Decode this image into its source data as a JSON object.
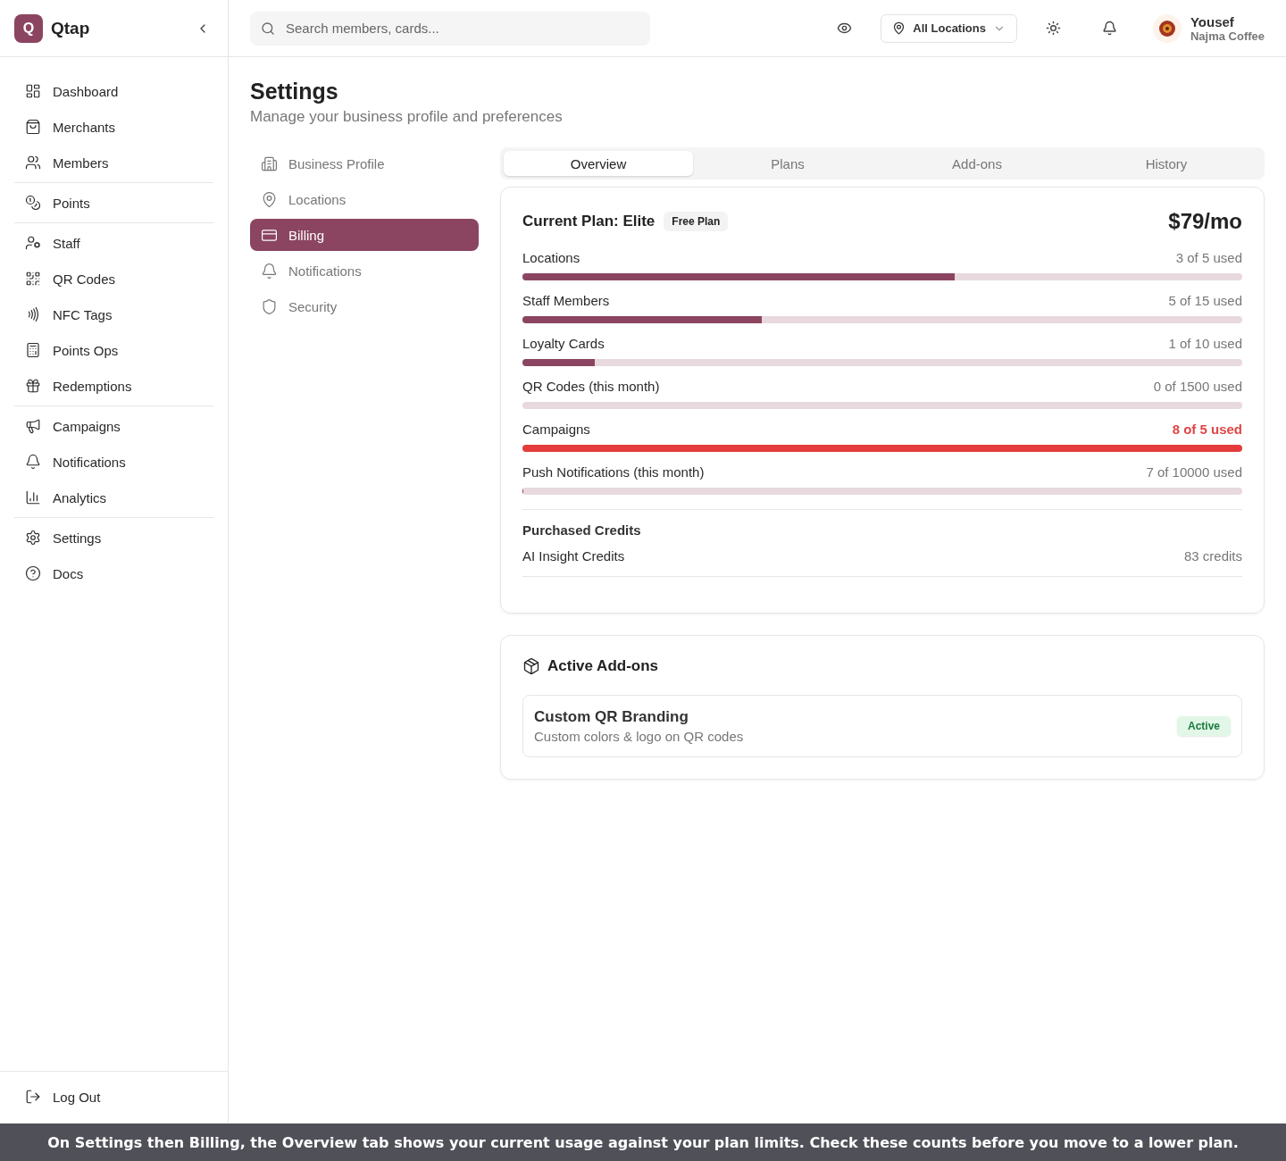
{
  "brand": {
    "letter": "Q",
    "name": "Qtap"
  },
  "nav_groups": [
    {
      "items": [
        {
          "label": "Dashboard",
          "selected": false
        },
        {
          "label": "Merchants",
          "selected": false
        },
        {
          "label": "Members",
          "selected": false
        }
      ]
    },
    {
      "items": [
        {
          "label": "Points",
          "selected": false
        }
      ]
    },
    {
      "items": [
        {
          "label": "Staff",
          "selected": false
        },
        {
          "label": "QR Codes",
          "selected": false
        },
        {
          "label": "NFC Tags",
          "selected": false
        },
        {
          "label": "Points Ops",
          "selected": false
        },
        {
          "label": "Redemptions",
          "selected": false
        }
      ]
    },
    {
      "items": [
        {
          "label": "Campaigns",
          "selected": false
        },
        {
          "label": "Notifications",
          "selected": false
        },
        {
          "label": "Analytics",
          "selected": false
        }
      ]
    },
    {
      "items": [
        {
          "label": "Settings",
          "selected": false
        },
        {
          "label": "Docs",
          "selected": false
        }
      ]
    }
  ],
  "logout": "Log Out",
  "search": {
    "placeholder": "Search members, cards..."
  },
  "location_select": "All Locations",
  "user": {
    "name": "Yousef",
    "business": "Najma Coffee"
  },
  "page": {
    "title": "Settings",
    "subtitle": "Manage your business profile and preferences"
  },
  "settings_menu": [
    {
      "label": "Business Profile",
      "selected": false
    },
    {
      "label": "Locations",
      "selected": false
    },
    {
      "label": "Billing",
      "selected": true
    },
    {
      "label": "Notifications",
      "selected": false
    },
    {
      "label": "Security",
      "selected": false
    }
  ],
  "tabs": [
    {
      "label": "Overview",
      "selected": true
    },
    {
      "label": "Plans",
      "selected": false
    },
    {
      "label": "Add-ons",
      "selected": false
    },
    {
      "label": "History",
      "selected": false
    }
  ],
  "plan": {
    "title": "Current Plan: Elite",
    "badge": "Free Plan",
    "price": "$79/mo"
  },
  "usage": [
    {
      "label": "Locations",
      "reading": "3 of 5 used",
      "level": 0.6,
      "over_limit": false
    },
    {
      "label": "Staff Members",
      "reading": "5 of 15 used",
      "level": 0.333,
      "over_limit": false
    },
    {
      "label": "Loyalty Cards",
      "reading": "1 of 10 used",
      "level": 0.1,
      "over_limit": false
    },
    {
      "label": "QR Codes (this month)",
      "reading": "0 of 1500 used",
      "level": 0,
      "over_limit": false
    },
    {
      "label": "Campaigns",
      "reading": "8 of 5 used",
      "level": 1,
      "over_limit": true
    },
    {
      "label": "Push Notifications (this month)",
      "reading": "7 of 10000 used",
      "level": 0.0007,
      "over_limit": false
    }
  ],
  "credits": {
    "title": "Purchased Credits",
    "items": [
      {
        "label": "AI Insight Credits",
        "value": "83 credits"
      }
    ]
  },
  "addons": {
    "title": "Active Add-ons",
    "items": [
      {
        "name": "Custom QR Branding",
        "description": "Custom colors & logo on QR codes",
        "status": "Active"
      }
    ]
  },
  "caption": "On Settings then Billing, the Overview tab shows your current usage against your plan limits. Check these counts before you move to a lower plan."
}
